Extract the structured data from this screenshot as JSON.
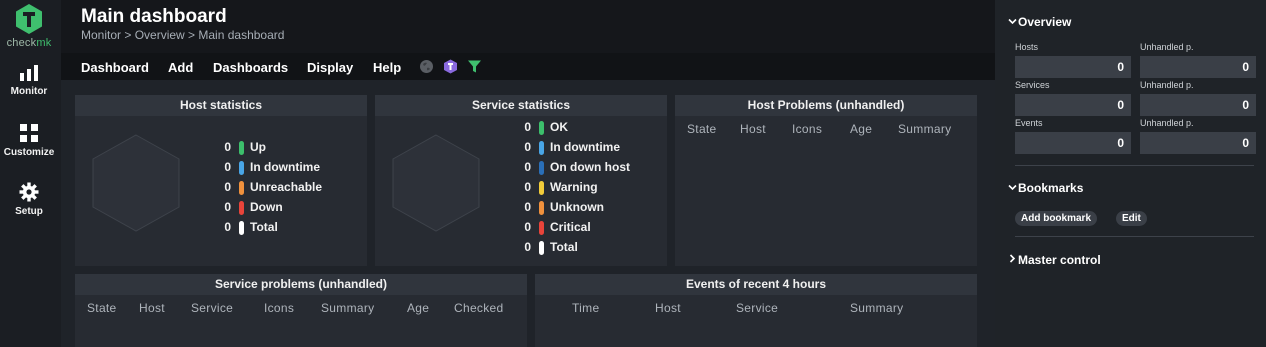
{
  "nav": {
    "logo_word_a": "check",
    "logo_word_b": "mk",
    "items": [
      {
        "label": "Monitor",
        "icon": "bar-chart-icon"
      },
      {
        "label": "Customize",
        "icon": "grid-icon"
      },
      {
        "label": "Setup",
        "icon": "gear-icon"
      }
    ]
  },
  "header": {
    "title": "Main dashboard",
    "breadcrumb": "Monitor > Overview > Main dashboard"
  },
  "menu": {
    "items": [
      "Dashboard",
      "Add",
      "Dashboards",
      "Display",
      "Help"
    ],
    "icons": [
      "globe-icon",
      "hexagon-badge-icon",
      "filter-icon"
    ]
  },
  "host_statistics": {
    "title": "Host statistics",
    "rows": [
      {
        "count": "0",
        "label": "Up",
        "color": "#3cbf6c"
      },
      {
        "count": "0",
        "label": "In downtime",
        "color": "#49a5e6"
      },
      {
        "count": "0",
        "label": "Unreachable",
        "color": "#f0913d"
      },
      {
        "count": "0",
        "label": "Down",
        "color": "#e8443a"
      },
      {
        "count": "0",
        "label": "Total",
        "color": "#ffffff"
      }
    ]
  },
  "service_statistics": {
    "title": "Service statistics",
    "rows": [
      {
        "count": "0",
        "label": "OK",
        "color": "#3cbf6c"
      },
      {
        "count": "0",
        "label": "In downtime",
        "color": "#49a5e6"
      },
      {
        "count": "0",
        "label": "On down host",
        "color": "#2a6fb8"
      },
      {
        "count": "0",
        "label": "Warning",
        "color": "#f2cc3a"
      },
      {
        "count": "0",
        "label": "Unknown",
        "color": "#f0913d"
      },
      {
        "count": "0",
        "label": "Critical",
        "color": "#e8443a"
      },
      {
        "count": "0",
        "label": "Total",
        "color": "#ffffff"
      }
    ]
  },
  "host_problems": {
    "title": "Host Problems (unhandled)",
    "columns": [
      "State",
      "Host",
      "Icons",
      "Age",
      "Summary"
    ]
  },
  "service_problems": {
    "title": "Service problems (unhandled)",
    "columns": [
      "State",
      "Host",
      "Service",
      "Icons",
      "Summary",
      "Age",
      "Checked"
    ]
  },
  "events": {
    "title": "Events of recent 4 hours",
    "columns": [
      "Time",
      "Host",
      "Service",
      "Summary"
    ]
  },
  "sidebar": {
    "overview": {
      "title": "Overview",
      "rows": [
        {
          "left_label": "Hosts",
          "left_value": "0",
          "right_label": "Unhandled p.",
          "right_value": "0"
        },
        {
          "left_label": "Services",
          "left_value": "0",
          "right_label": "Unhandled p.",
          "right_value": "0"
        },
        {
          "left_label": "Events",
          "left_value": "0",
          "right_label": "Unhandled p.",
          "right_value": "0"
        }
      ]
    },
    "bookmarks": {
      "title": "Bookmarks",
      "add_label": "Add bookmark",
      "edit_label": "Edit"
    },
    "master_control": {
      "title": "Master control"
    }
  }
}
